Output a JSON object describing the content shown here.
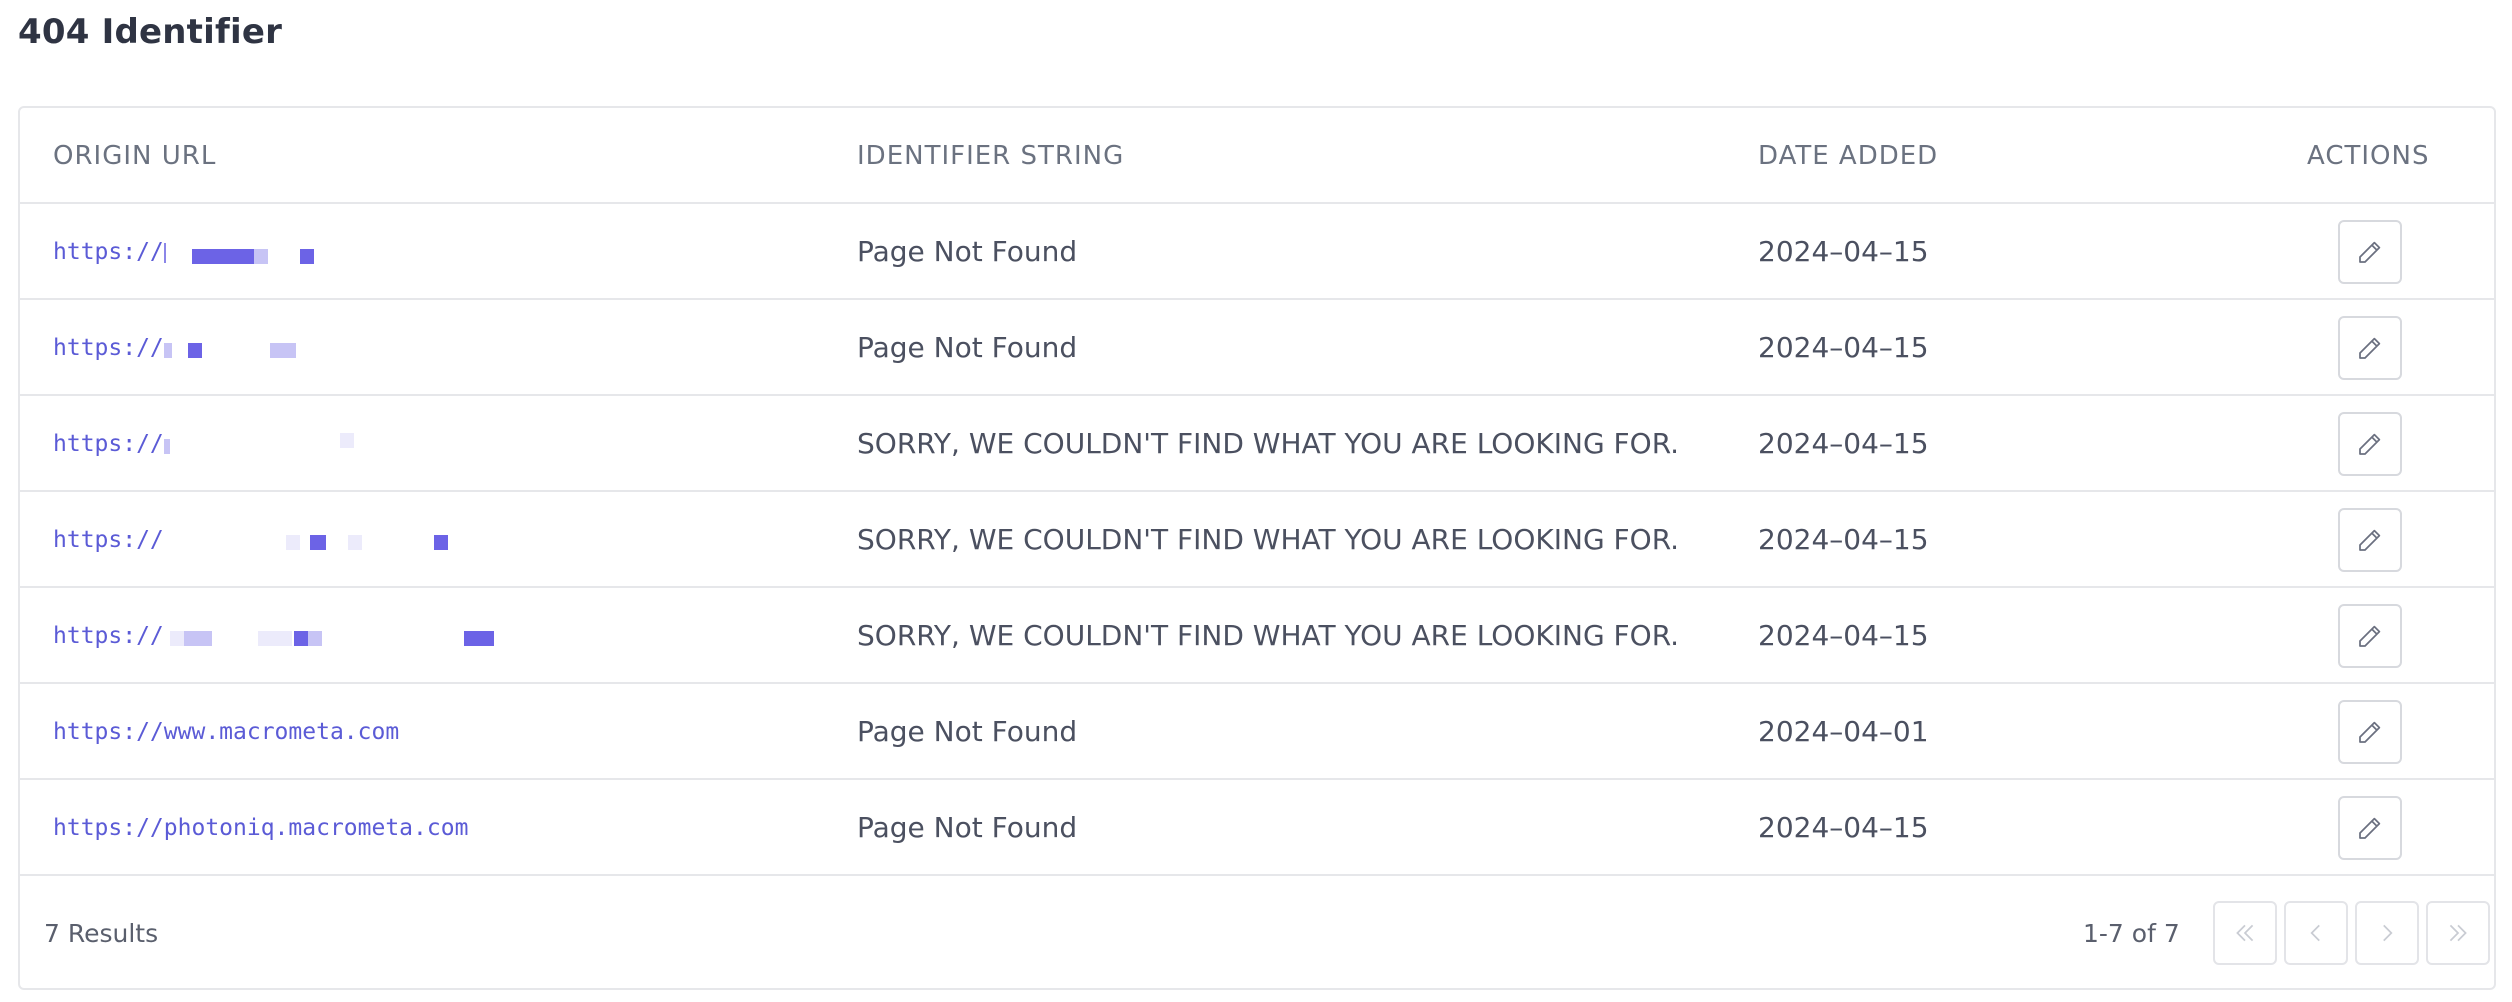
{
  "page": {
    "title": "404 Identifier"
  },
  "table": {
    "headers": {
      "origin_url": "ORIGIN URL",
      "identifier_string": "IDENTIFIER STRING",
      "date_added": "DATE ADDED",
      "actions": "ACTIONS"
    },
    "rows": [
      {
        "url": "https://",
        "url_redacted": true,
        "identifier": "Page Not Found",
        "date": "2024–04–15"
      },
      {
        "url": "https://",
        "url_redacted": true,
        "identifier": "Page Not Found",
        "date": "2024–04–15"
      },
      {
        "url": "https://",
        "url_redacted": true,
        "identifier": "SORRY, WE COULDN'T FIND WHAT YOU ARE LOOKING FOR.",
        "date": "2024–04–15"
      },
      {
        "url": "https://",
        "url_redacted": true,
        "identifier": "SORRY, WE COULDN'T FIND WHAT YOU ARE LOOKING FOR.",
        "date": "2024–04–15"
      },
      {
        "url": "https://",
        "url_redacted": true,
        "identifier": "SORRY, WE COULDN'T FIND WHAT YOU ARE LOOKING FOR.",
        "date": "2024–04–15"
      },
      {
        "url": "https://www.macrometa.com",
        "url_redacted": false,
        "identifier": "Page Not Found",
        "date": "2024–04–01"
      },
      {
        "url": "https://photoniq.macrometa.com",
        "url_redacted": false,
        "identifier": "Page Not Found",
        "date": "2024–04–15"
      }
    ],
    "row_action_icon": "pencil-icon"
  },
  "footer": {
    "results": "7 Results",
    "range": "1-7 of 7",
    "pagination_icons": [
      "double-chevron-left-icon",
      "chevron-left-icon",
      "chevron-right-icon",
      "double-chevron-right-icon"
    ]
  },
  "colors": {
    "link": "#5b5bd6",
    "border": "#e6e7ea",
    "header_text": "#6b7280",
    "title_text": "#2f3443"
  }
}
